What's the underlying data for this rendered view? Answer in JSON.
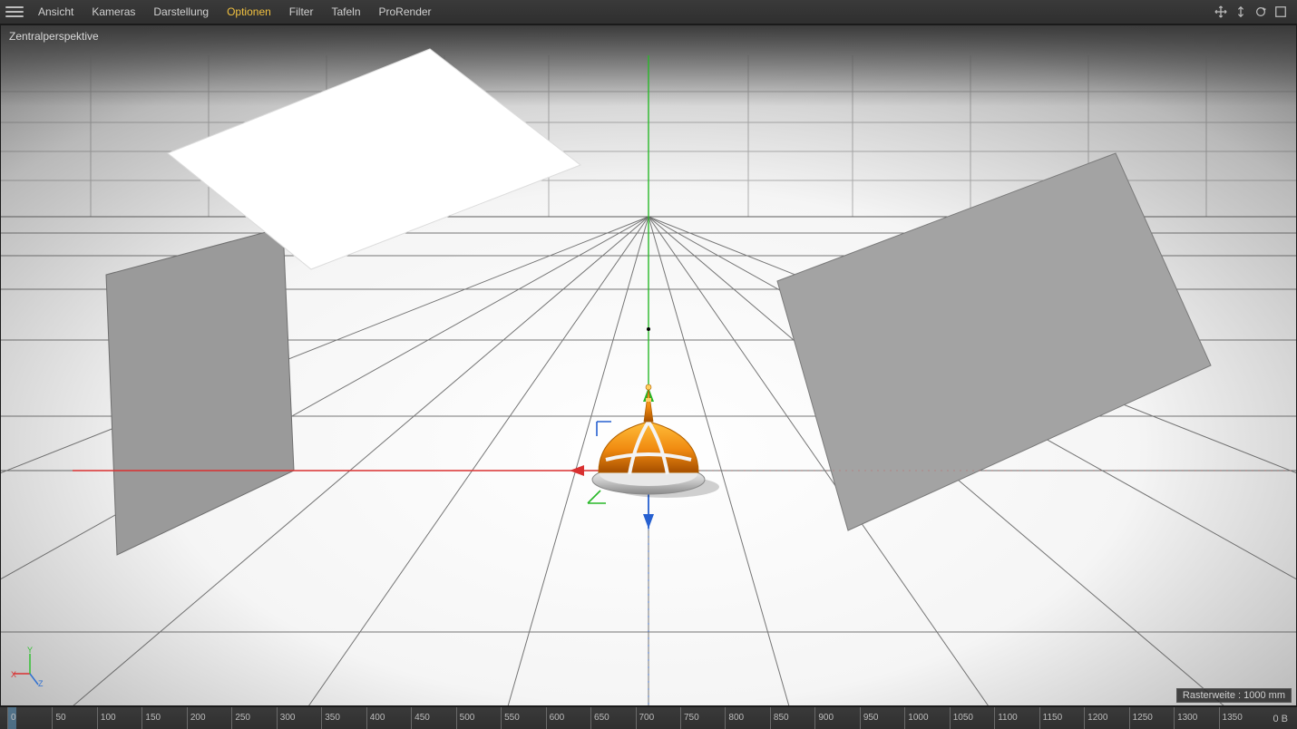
{
  "menu": {
    "items": [
      {
        "label": "Ansicht",
        "active": false
      },
      {
        "label": "Kameras",
        "active": false
      },
      {
        "label": "Darstellung",
        "active": false
      },
      {
        "label": "Optionen",
        "active": true
      },
      {
        "label": "Filter",
        "active": false
      },
      {
        "label": "Tafeln",
        "active": false
      },
      {
        "label": "ProRender",
        "active": false
      }
    ]
  },
  "viewport": {
    "label": "Zentralperspektive",
    "raster_label": "Rasterweite : 1000 mm",
    "axis": {
      "x": "X",
      "y": "Y",
      "z": "Z"
    },
    "colors": {
      "x": "#d93030",
      "y": "#30c030",
      "z": "#3070d0"
    }
  },
  "timeline": {
    "ticks": [
      "0",
      "50",
      "100",
      "150",
      "200",
      "250",
      "300",
      "350",
      "400",
      "450",
      "500",
      "550",
      "600",
      "650",
      "700",
      "750",
      "800",
      "850",
      "900",
      "950",
      "1000",
      "1050",
      "1100",
      "1150",
      "1200",
      "1250",
      "1300",
      "1350"
    ],
    "end_label": "0 B"
  }
}
